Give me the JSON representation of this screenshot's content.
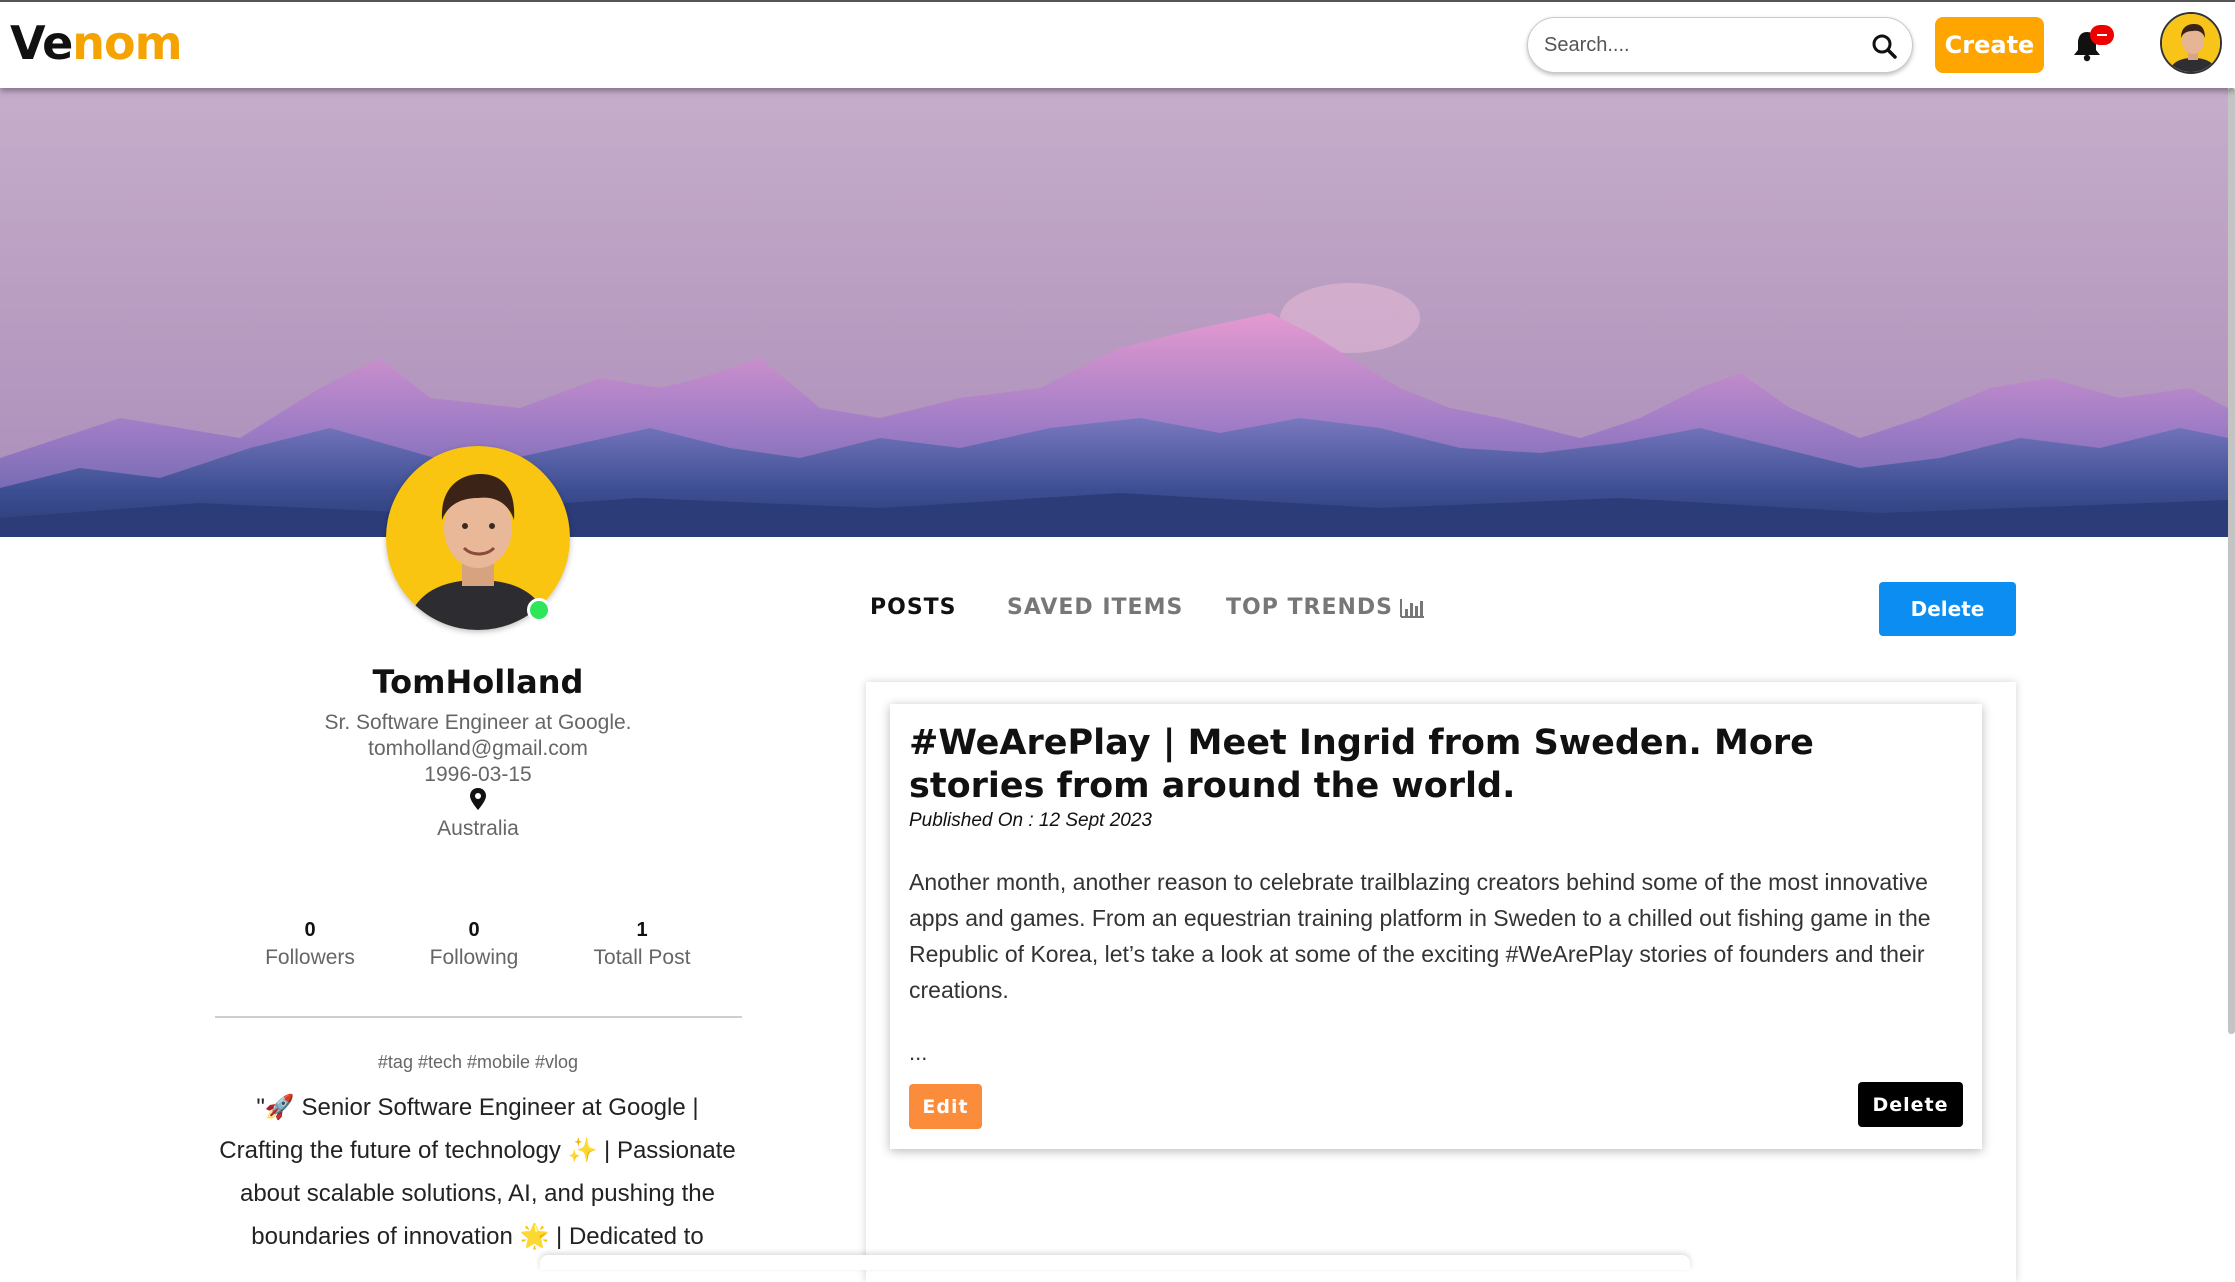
{
  "navbar": {
    "logo_part1": "Ve",
    "logo_part2": "nom",
    "search_placeholder": "Search....",
    "create_label": "Create",
    "brand_color": "#ffa500"
  },
  "profile": {
    "name": "TomHolland",
    "title": "Sr. Software Engineer at Google.",
    "email": "tomholland@gmail.com",
    "dob": "1996-03-15",
    "location": "Australia",
    "online": true,
    "stats": [
      {
        "value": "0",
        "label": "Followers"
      },
      {
        "value": "0",
        "label": "Following"
      },
      {
        "value": "1",
        "label": "Totall Post"
      }
    ],
    "tags": "#tag #tech #mobile #vlog",
    "bio_lines": [
      "\"🚀 Senior Software Engineer at Google |",
      "Crafting the future of technology ✨ | Passionate",
      "about scalable solutions, AI, and pushing the",
      "boundaries of innovation 🌟 | Dedicated to"
    ]
  },
  "tabs": [
    {
      "label": "POSTS",
      "active": true
    },
    {
      "label": "SAVED ITEMS",
      "active": false
    },
    {
      "label": "TOP TRENDS",
      "active": false
    }
  ],
  "top_delete_label": "Delete",
  "post": {
    "title": "#WeArePlay | Meet Ingrid from Sweden. More stories from around the world.",
    "published": "Published On : 12 Sept 2023",
    "body": "Another month, another reason to celebrate trailblazing creators behind some of the most innovative apps and games. From an equestrian training platform in Sweden to a chilled out fishing game in the Republic of Korea, let’s take a look at some of the exciting #WeArePlay stories of founders and their creations.",
    "ellipsis": "...",
    "edit_label": "Edit",
    "delete_label": "Delete"
  }
}
